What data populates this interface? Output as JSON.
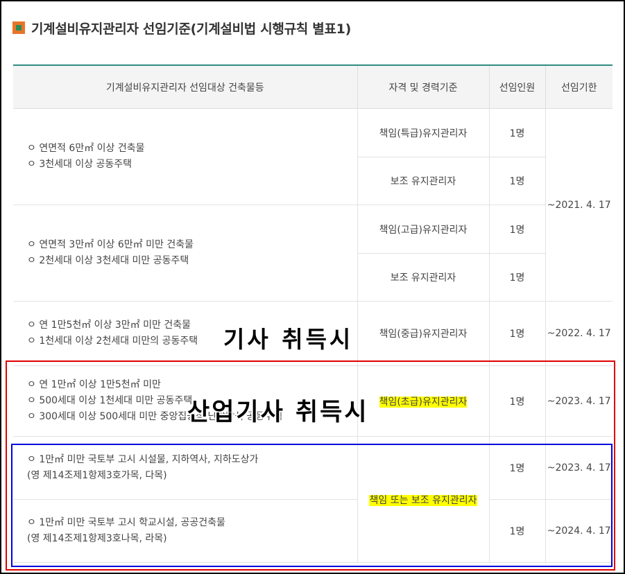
{
  "heading": "기계설비유지관리자 선임기준(기계설비법 시행규칙 별표1)",
  "colors": {
    "accent": "#2f8a80",
    "bullet_outer": "#e8742a",
    "bullet_inner": "#2e8b57",
    "highlight": "#ffff00",
    "red_box": "#e00000",
    "blue_box": "#0000dd"
  },
  "table": {
    "headers": [
      "기계설비유지관리자 선임대상 건축물등",
      "자격 및 경력기준",
      "선임인원",
      "선임기한"
    ],
    "groups": [
      {
        "targets": [
          "ㅇ 연면적 6만㎡ 이상 건축물",
          "ㅇ 3천세대 이상 공동주택"
        ],
        "roles": [
          {
            "qualification": "책임(특급)유지관리자",
            "count": "1명"
          },
          {
            "qualification": "보조 유지관리자",
            "count": "1명"
          }
        ]
      },
      {
        "targets": [
          "ㅇ 연면적 3만㎡ 이상 6만㎡ 미만 건축물",
          "ㅇ 2천세대 이상 3천세대 미만 공동주택"
        ],
        "roles": [
          {
            "qualification": "책임(고급)유지관리자",
            "count": "1명"
          },
          {
            "qualification": "보조 유지관리자",
            "count": "1명"
          }
        ]
      },
      {
        "targets": [
          "ㅇ 연 1만5천㎡ 이상 3만㎡ 미만 건축물",
          "ㅇ 1천세대 이상 2천세대 미만의 공동주택"
        ],
        "roles": [
          {
            "qualification": "책임(중급)유지관리자",
            "count": "1명"
          }
        ]
      },
      {
        "targets": [
          "ㅇ 연 1만㎡ 이상 1만5천㎡ 미만",
          "ㅇ 500세대 이상 1천세대 미만 공동주택",
          "ㅇ 300세대 이상 500세대 미만 중앙집중식 난방방식 공동주택"
        ],
        "roles": [
          {
            "qualification": "책임(초급)유지관리자",
            "count": "1명"
          }
        ]
      },
      {
        "targets": [
          "ㅇ 1만㎡ 미만 국토부 고시 시설물, 지하역사, 지하도상가",
          "(영 제14조제1항제3호가목, 다목)"
        ],
        "roles": [
          {
            "qualification": "책임 또는 보조 유지관리자",
            "count": "1명"
          }
        ]
      },
      {
        "targets": [
          "ㅇ 1만㎡ 미만 국토부 고시 학교시설, 공공건축물",
          "(영 제14조제1항제3호나목, 라목)"
        ],
        "roles": [
          {
            "count": "1명"
          }
        ]
      }
    ],
    "deadlines": [
      "~2021. 4. 17",
      "~2022. 4. 17",
      "~2023. 4. 17",
      "~2023. 4. 17",
      "~2024. 4. 17"
    ]
  },
  "annotations": {
    "engineer": "기사  취득시",
    "industrial_engineer": "산업기사  취득시"
  }
}
